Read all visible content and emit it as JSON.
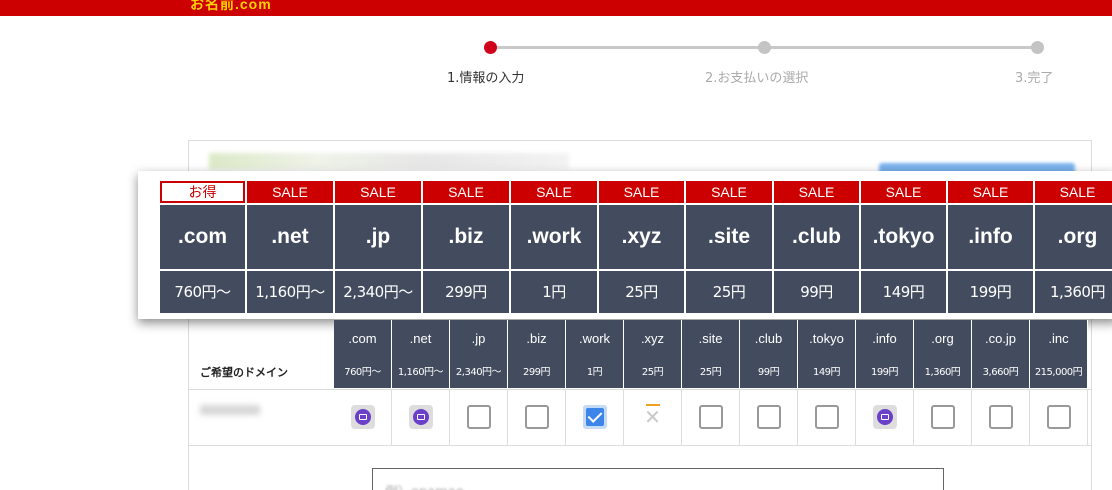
{
  "header": {
    "logo_text": "お名前.com"
  },
  "stepper": {
    "steps": [
      {
        "label": "1.情報の入力"
      },
      {
        "label": "2.お支払いの選択"
      },
      {
        "label": "3.完了"
      }
    ]
  },
  "promo_table": {
    "columns": [
      {
        "badge": "お得",
        "tld": ".com",
        "price": "760円～"
      },
      {
        "badge": "SALE",
        "tld": ".net",
        "price": "1,160円～"
      },
      {
        "badge": "SALE",
        "tld": ".jp",
        "price": "2,340円～"
      },
      {
        "badge": "SALE",
        "tld": ".biz",
        "price": "299円"
      },
      {
        "badge": "SALE",
        "tld": ".work",
        "price": "1円"
      },
      {
        "badge": "SALE",
        "tld": ".xyz",
        "price": "25円"
      },
      {
        "badge": "SALE",
        "tld": ".site",
        "price": "25円"
      },
      {
        "badge": "SALE",
        "tld": ".club",
        "price": "99円"
      },
      {
        "badge": "SALE",
        "tld": ".tokyo",
        "price": "149円"
      },
      {
        "badge": "SALE",
        "tld": ".info",
        "price": "199円"
      },
      {
        "badge": "SALE",
        "tld": ".org",
        "price": "1,360円"
      }
    ]
  },
  "domain_table": {
    "row_label": "ご希望のドメイン",
    "columns": [
      {
        "tld": ".com",
        "price": "760円～",
        "state": "mail"
      },
      {
        "tld": ".net",
        "price": "1,160円～",
        "state": "mail"
      },
      {
        "tld": ".jp",
        "price": "2,340円～",
        "state": "empty"
      },
      {
        "tld": ".biz",
        "price": "299円",
        "state": "empty"
      },
      {
        "tld": ".work",
        "price": "1円",
        "state": "checked"
      },
      {
        "tld": ".xyz",
        "price": "25円",
        "state": "unavailable"
      },
      {
        "tld": ".site",
        "price": "25円",
        "state": "empty"
      },
      {
        "tld": ".club",
        "price": "99円",
        "state": "empty"
      },
      {
        "tld": ".tokyo",
        "price": "149円",
        "state": "empty"
      },
      {
        "tld": ".info",
        "price": "199円",
        "state": "mail"
      },
      {
        "tld": ".org",
        "price": "1,360円",
        "state": "empty"
      },
      {
        "tld": ".co.jp",
        "price": "3,660円",
        "state": "empty"
      },
      {
        "tld": ".inc",
        "price": "215,000円",
        "state": "empty"
      }
    ]
  },
  "search": {
    "placeholder": "例）onamae"
  },
  "colors": {
    "brand_red": "#cc0000",
    "header_dark": "#434c5e",
    "accent_blue": "#3b86e8",
    "icon_purple": "#6b3fc7"
  }
}
